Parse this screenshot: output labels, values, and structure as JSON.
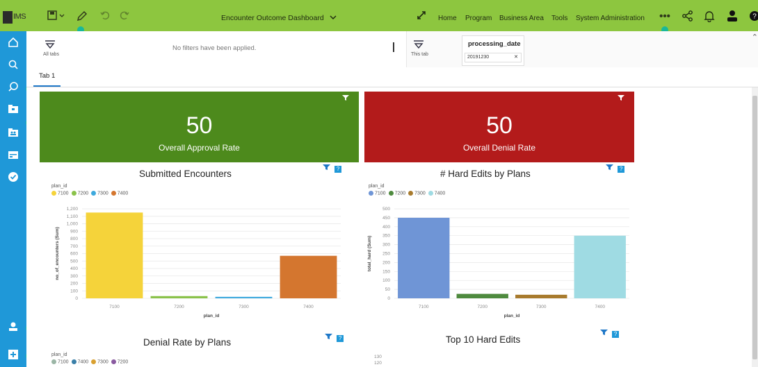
{
  "app": {
    "logo_text": "IMS"
  },
  "toolbar": {
    "dashboard_title": "Encounter Outcome Dashboard"
  },
  "nav": {
    "items": [
      "Home",
      "Program",
      "Business Area",
      "Tools",
      "System Administration"
    ]
  },
  "filters": {
    "all_tabs_label": "All tabs",
    "no_filters_msg": "No filters have been applied.",
    "this_tab_label": "This tab",
    "field_title": "processing_date",
    "field_value": "20191230"
  },
  "tabs": [
    {
      "label": "Tab 1"
    }
  ],
  "kpis": [
    {
      "value": "50",
      "label": "Overall Approval Rate",
      "color": "#4d8a1c"
    },
    {
      "value": "50",
      "label": "Overall Denial Rate",
      "color": "#b31b1b"
    }
  ],
  "charts": {
    "submitted": {
      "title": "Submitted Encounters",
      "legend_title": "plan_id",
      "ylabel": "no_of_encounters (Sum)",
      "xlabel": "plan_id",
      "yticks": [
        "1,200",
        "1,100",
        "1,000",
        "900",
        "800",
        "700",
        "600",
        "500",
        "400",
        "300",
        "200",
        "100",
        "0"
      ]
    },
    "hardedits": {
      "title": "# Hard Edits by Plans",
      "legend_title": "plan_id",
      "ylabel": "total_hard (Sum)",
      "xlabel": "plan_id",
      "yticks": [
        "500",
        "450",
        "400",
        "350",
        "300",
        "250",
        "200",
        "150",
        "100",
        "50",
        "0"
      ]
    },
    "denial": {
      "title": "Denial Rate by Plans",
      "legend_title": "plan_id",
      "legend": [
        {
          "name": "7100",
          "color": "#9bb6a6"
        },
        {
          "name": "7400",
          "color": "#3a7fa8"
        },
        {
          "name": "7300",
          "color": "#d9a030"
        },
        {
          "name": "7200",
          "color": "#8a5aa0"
        }
      ]
    },
    "top10": {
      "title": "Top 10 Hard Edits",
      "yticks": [
        "130",
        "120"
      ]
    }
  },
  "chart_data": [
    {
      "type": "bar",
      "title": "Submitted Encounters",
      "xlabel": "plan_id",
      "ylabel": "no_of_encounters (Sum)",
      "categories": [
        "7100",
        "7200",
        "7300",
        "7400"
      ],
      "values": [
        1150,
        30,
        20,
        570
      ],
      "colors": [
        "#f5d33a",
        "#8ac24a",
        "#3ea9dd",
        "#d4762f"
      ],
      "ylim": [
        0,
        1200
      ]
    },
    {
      "type": "bar",
      "title": "# Hard Edits by Plans",
      "xlabel": "plan_id",
      "ylabel": "total_hard (Sum)",
      "categories": [
        "7100",
        "7200",
        "7300",
        "7400"
      ],
      "values": [
        450,
        25,
        20,
        350
      ],
      "colors": [
        "#6f95d6",
        "#4e8a3e",
        "#a87b2e",
        "#9fdbe3"
      ],
      "ylim": [
        0,
        500
      ]
    }
  ]
}
